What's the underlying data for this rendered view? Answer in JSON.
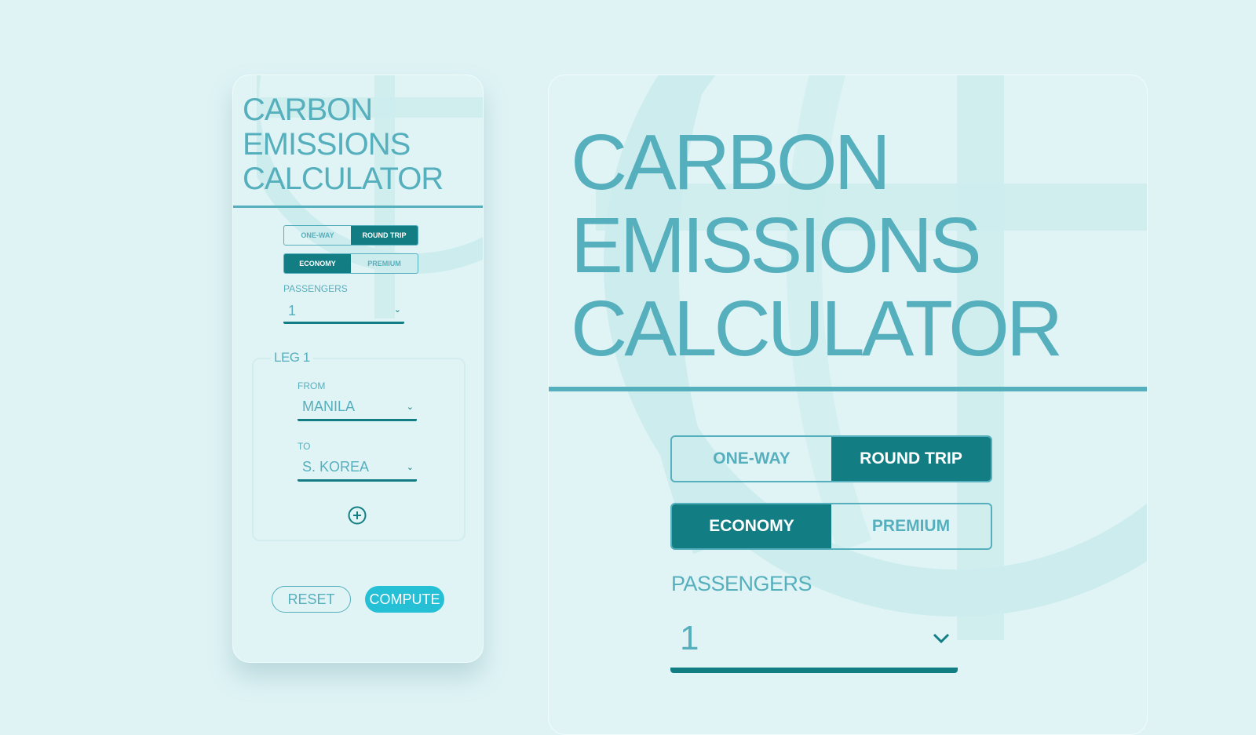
{
  "colors": {
    "background": "#dff3f5",
    "card": "#e0f4f6",
    "title": "#56afbd",
    "primary_dark": "#127e84",
    "compute": "#25bfd6",
    "globe_watermark": "#cdeced"
  },
  "mobile": {
    "title_lines": [
      "CARBON",
      "EMISSIONS",
      "CALCULATOR"
    ],
    "trip_type": {
      "options": [
        "ONE-WAY",
        "ROUND TRIP"
      ],
      "selected": "ROUND TRIP"
    },
    "cabin_class": {
      "options": [
        "ECONOMY",
        "PREMIUM"
      ],
      "selected": "ECONOMY"
    },
    "passengers": {
      "label": "PASSENGERS",
      "value": "1",
      "icon": "chevron-down-icon"
    },
    "leg": {
      "title": "LEG 1",
      "from": {
        "label": "FROM",
        "value": "MANILA",
        "icon": "chevron-down-icon"
      },
      "to": {
        "label": "TO",
        "value": "S. KOREA",
        "icon": "chevron-down-icon"
      },
      "add_icon": "plus-circle-icon"
    },
    "actions": {
      "reset": "RESET",
      "compute": "COMPUTE"
    }
  },
  "desktop": {
    "title_lines": [
      "CARBON",
      "EMISSIONS",
      "CALCULATOR"
    ],
    "trip_type": {
      "options": [
        "ONE-WAY",
        "ROUND TRIP"
      ],
      "selected": "ROUND TRIP"
    },
    "cabin_class": {
      "options": [
        "ECONOMY",
        "PREMIUM"
      ],
      "selected": "ECONOMY"
    },
    "passengers": {
      "label": "PASSENGERS",
      "value": "1",
      "icon": "chevron-down-icon"
    }
  },
  "glyphs": {
    "chevron": "⌄"
  }
}
